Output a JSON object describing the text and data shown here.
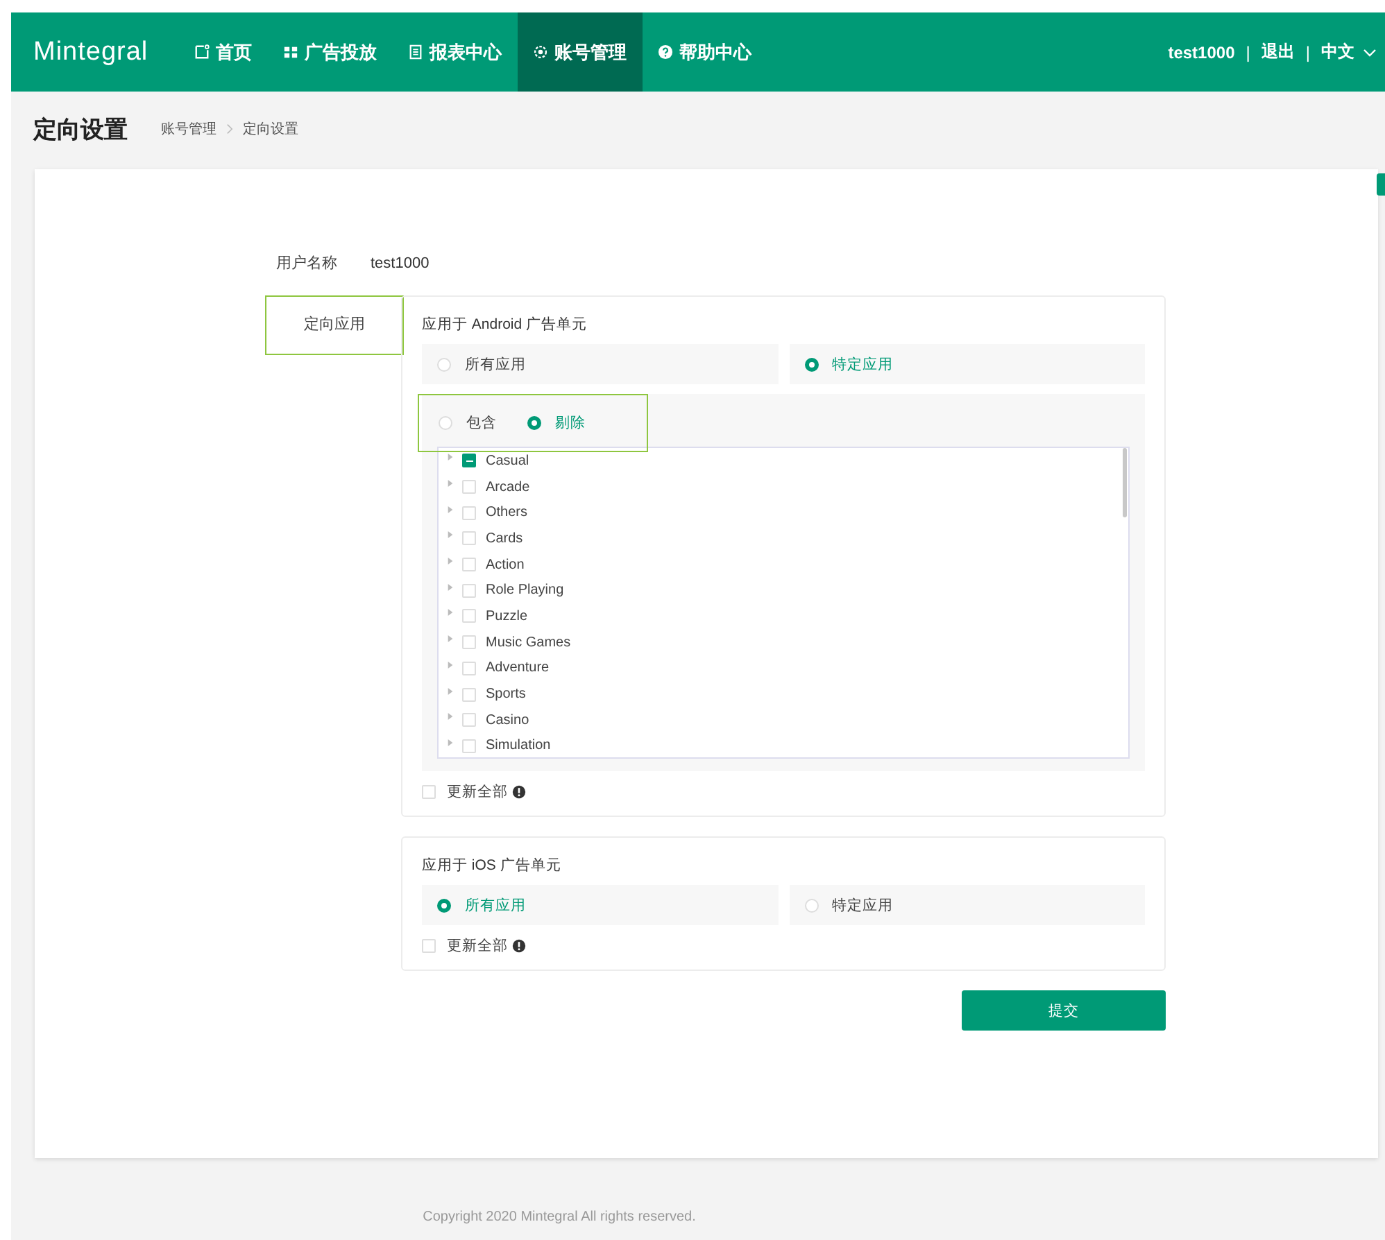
{
  "header": {
    "logo": "Mintegral",
    "nav": [
      {
        "label": "首页",
        "selected": false
      },
      {
        "label": "广告投放",
        "selected": false
      },
      {
        "label": "报表中心",
        "selected": false
      },
      {
        "label": "账号管理",
        "selected": true
      },
      {
        "label": "帮助中心",
        "selected": false
      }
    ],
    "user": "test1000",
    "separator": "|",
    "logout": "退出",
    "language": "中文"
  },
  "page": {
    "title": "定向设置",
    "breadcrumb": [
      "账号管理",
      "定向设置"
    ]
  },
  "form": {
    "username": {
      "label": "用户名称",
      "value": "test1000"
    },
    "target": {
      "label": "定向应用",
      "highlighted": true
    },
    "android": {
      "title": "应用于 Android 广告单元",
      "options": [
        {
          "label": "所有应用",
          "selected": false
        },
        {
          "label": "特定应用",
          "selected": true
        }
      ],
      "mode": {
        "highlighted": true,
        "options": [
          {
            "label": "包含",
            "selected": false
          },
          {
            "label": "剔除",
            "selected": true
          }
        ]
      },
      "tree": [
        {
          "label": "Casual",
          "indeterminate": true
        },
        {
          "label": "Arcade",
          "indeterminate": false
        },
        {
          "label": "Others",
          "indeterminate": false
        },
        {
          "label": "Cards",
          "indeterminate": false
        },
        {
          "label": "Action",
          "indeterminate": false
        },
        {
          "label": "Role Playing",
          "indeterminate": false
        },
        {
          "label": "Puzzle",
          "indeterminate": false
        },
        {
          "label": "Music Games",
          "indeterminate": false
        },
        {
          "label": "Adventure",
          "indeterminate": false
        },
        {
          "label": "Sports",
          "indeterminate": false
        },
        {
          "label": "Casino",
          "indeterminate": false
        },
        {
          "label": "Simulation",
          "indeterminate": false
        }
      ],
      "update_all": {
        "label": "更新全部",
        "checked": false
      }
    },
    "ios": {
      "title": "应用于 iOS 广告单元",
      "options": [
        {
          "label": "所有应用",
          "selected": true
        },
        {
          "label": "特定应用",
          "selected": false
        }
      ],
      "update_all": {
        "label": "更新全部",
        "checked": false
      }
    },
    "submit": "提交"
  },
  "footer": "Copyright 2020 Mintegral All rights reserved."
}
